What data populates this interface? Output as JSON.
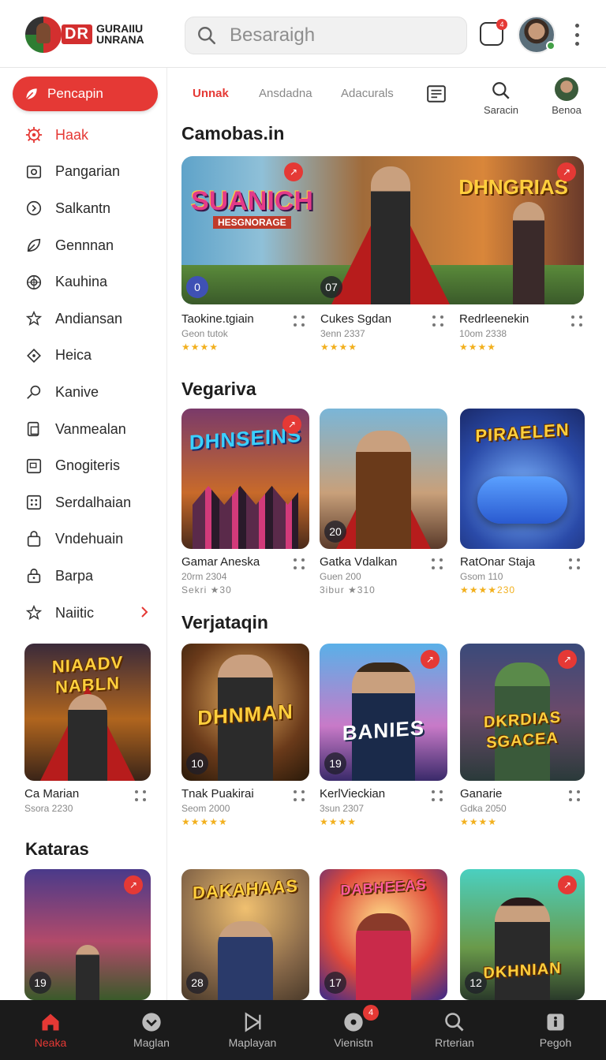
{
  "header": {
    "logo_badge": "DR",
    "logo_text_1": "GURAIIU",
    "logo_text_2": "UNRANA",
    "search_placeholder": "Besaraigh",
    "notif_count": "4"
  },
  "sidebar": {
    "cta_label": "Pencapin",
    "items": [
      {
        "label": "Haak",
        "icon": "gear-icon",
        "active": true
      },
      {
        "label": "Pangarian",
        "icon": "camera-icon"
      },
      {
        "label": "Salkantn",
        "icon": "clock-icon"
      },
      {
        "label": "Gennnan",
        "icon": "leaf-icon"
      },
      {
        "label": "Kauhina",
        "icon": "target-icon"
      },
      {
        "label": "Andiansan",
        "icon": "star-outline-icon"
      },
      {
        "label": "Heica",
        "icon": "diamond-icon"
      },
      {
        "label": "Kanive",
        "icon": "key-icon"
      },
      {
        "label": "Vanmealan",
        "icon": "document-icon"
      },
      {
        "label": "Gnogiteris",
        "icon": "window-icon"
      },
      {
        "label": "Serdalhaian",
        "icon": "grid-icon"
      },
      {
        "label": "Vndehuain",
        "icon": "bag-icon"
      },
      {
        "label": "Barpa",
        "icon": "lock-icon"
      },
      {
        "label": "Naiitic",
        "icon": "star-icon"
      }
    ],
    "card1": {
      "art": "NIAADV NABLN",
      "title": "Ca Marian",
      "sub": "Ssora 2230"
    },
    "section": "Kataras",
    "card2": {
      "num": "19"
    }
  },
  "tabs": [
    {
      "label": "Unnak",
      "active": true
    },
    {
      "label": "Ansdadna"
    },
    {
      "label": "Adacurals"
    }
  ],
  "tab_icons": [
    {
      "label": "",
      "icon": "list-icon"
    },
    {
      "label": "Saracin",
      "icon": "search-icon"
    },
    {
      "label": "Benoa",
      "icon": "avatar-icon"
    }
  ],
  "sections": [
    {
      "title": "Camobas.in",
      "hero_left": "SUANICH",
      "hero_left_sub": "HESGNORAGE",
      "hero_right": "DHNGRIAS",
      "hero_badges": [
        "0",
        "07"
      ],
      "cards": [
        {
          "title": "Taokine.tgiain",
          "sub": "Geon  tutok",
          "rating": "★★★★"
        },
        {
          "title": "Cukes Sgdan",
          "sub": "3enn  2337",
          "rating": "★★★★"
        },
        {
          "title": "Redrleenekin",
          "sub": "10om  2338",
          "rating": "★★★★"
        }
      ]
    },
    {
      "title": "Vegariva",
      "cards": [
        {
          "art": "DHNSEINS",
          "title": "Gamar Aneska",
          "sub": "20rm  2304",
          "rating": "Sekri ★30",
          "num": ""
        },
        {
          "art": "",
          "title": "Gatka Vdalkan",
          "sub": "Guen  200",
          "rating": "3ibur ★310",
          "num": "20"
        },
        {
          "art": "PIRAELEN",
          "title": "RatOnar Staja",
          "sub": "Gsom  110",
          "rating": "★★★★230",
          "num": ""
        }
      ]
    },
    {
      "title": "Verjataqin",
      "cards": [
        {
          "art": "DHNMAN",
          "title": "Tnak Puakirai",
          "sub": "Seom  2000",
          "rating": "★★★★★",
          "num": "10"
        },
        {
          "art": "BANIES",
          "title": "KerlVieckian",
          "sub": "3sun  2307",
          "rating": "★★★★",
          "num": "19"
        },
        {
          "art": "DKRDIAS SGACEA",
          "title": "Ganarie",
          "sub": "Gdka  2050",
          "rating": "★★★★",
          "num": ""
        }
      ]
    },
    {
      "title": "",
      "cards": [
        {
          "art": "DAKAHAAS",
          "num": "28"
        },
        {
          "art": "DABHEEAS",
          "num": "17"
        },
        {
          "art": "DKHNIAN",
          "num": "12"
        }
      ]
    }
  ],
  "bottom_nav": [
    {
      "label": "Neaka",
      "icon": "home-icon",
      "active": true
    },
    {
      "label": "Maglan",
      "icon": "chevron-circle-icon"
    },
    {
      "label": "Maplayan",
      "icon": "play-icon"
    },
    {
      "label": "Vienistn",
      "icon": "disc-icon",
      "badge": "4"
    },
    {
      "label": "Rrterian",
      "icon": "search-icon"
    },
    {
      "label": "Pegoh",
      "icon": "lock-icon"
    }
  ],
  "colors": {
    "accent": "#e53935",
    "star": "#f2b01e",
    "bottom_bar": "#1b1b1b"
  }
}
